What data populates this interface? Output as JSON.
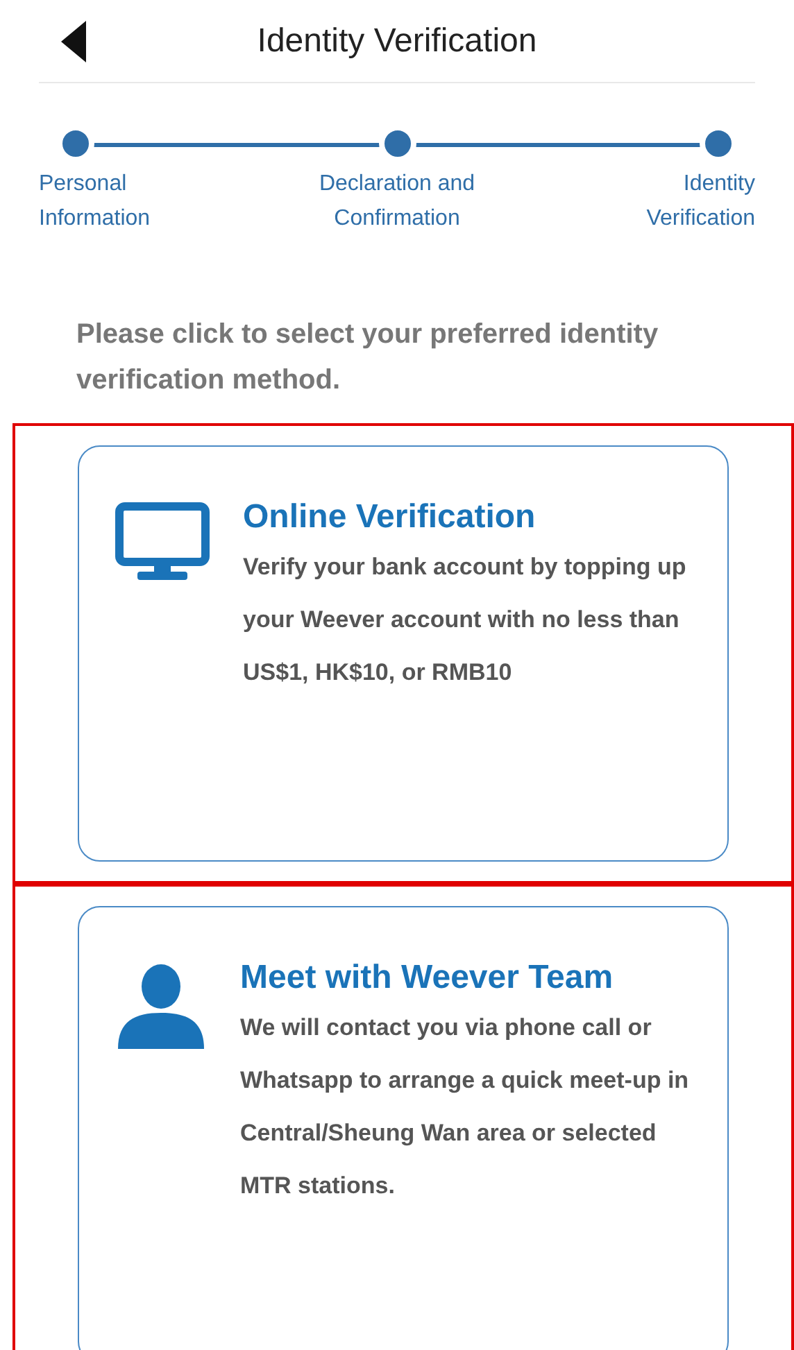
{
  "header": {
    "title": "Identity Verification"
  },
  "steps": [
    {
      "label": "Personal Information",
      "completed": true
    },
    {
      "label": "Declaration and Confirmation",
      "completed": true
    },
    {
      "label": "Identity Verification",
      "completed": true
    }
  ],
  "instruction": "Please click to select your preferred identity verification method.",
  "methods": [
    {
      "kind": "monitor",
      "title": "Online Verification",
      "description": "Verify your bank account by topping up your Weever account with no less than US$1, HK$10, or RMB10",
      "highlighted": true
    },
    {
      "kind": "person",
      "title": "Meet with Weever Team",
      "description": "We will contact you via phone call or Whatsapp to arrange a quick meet-up in Central/Sheung Wan area or selected MTR stations.",
      "highlighted": true
    }
  ]
}
